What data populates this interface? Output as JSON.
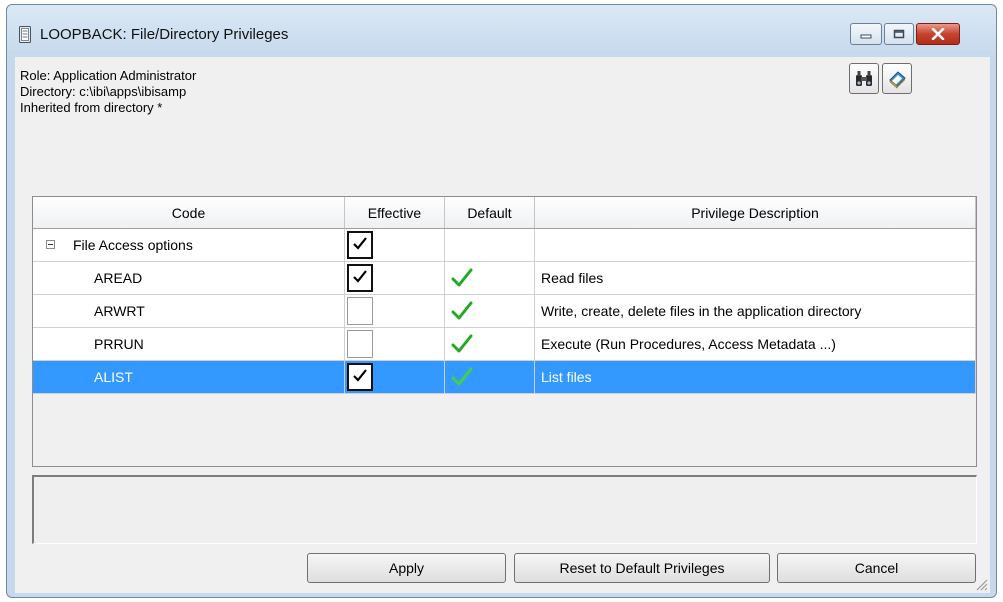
{
  "window": {
    "title": "LOOPBACK: File/Directory Privileges"
  },
  "info": {
    "role": "Role: Application Administrator",
    "directory": "Directory: c:\\ibi\\apps\\ibisamp",
    "inherited": "Inherited from directory *"
  },
  "toolbar": {
    "find_icon": "binoculars-icon",
    "help_icon": "help-book-icon"
  },
  "table": {
    "columns": [
      "Code",
      "Effective",
      "Default",
      "Privilege Description"
    ],
    "group": {
      "label": "File Access options",
      "expanded": true,
      "effective": true
    },
    "rows": [
      {
        "code": "AREAD",
        "effective": true,
        "default": true,
        "description": "Read files",
        "selected": false
      },
      {
        "code": "ARWRT",
        "effective": false,
        "default": true,
        "description": "Write, create, delete files in the application directory",
        "selected": false
      },
      {
        "code": "PRRUN",
        "effective": false,
        "default": true,
        "description": "Execute (Run Procedures, Access Metadata ...)",
        "selected": false
      },
      {
        "code": "ALIST",
        "effective": true,
        "default": true,
        "description": "List files",
        "selected": true
      }
    ]
  },
  "buttons": {
    "apply": "Apply",
    "reset": "Reset to Default Privileges",
    "cancel": "Cancel"
  },
  "colors": {
    "selection": "#3399ff",
    "default_tick": "#22aa22",
    "close_button": "#c6432e"
  }
}
